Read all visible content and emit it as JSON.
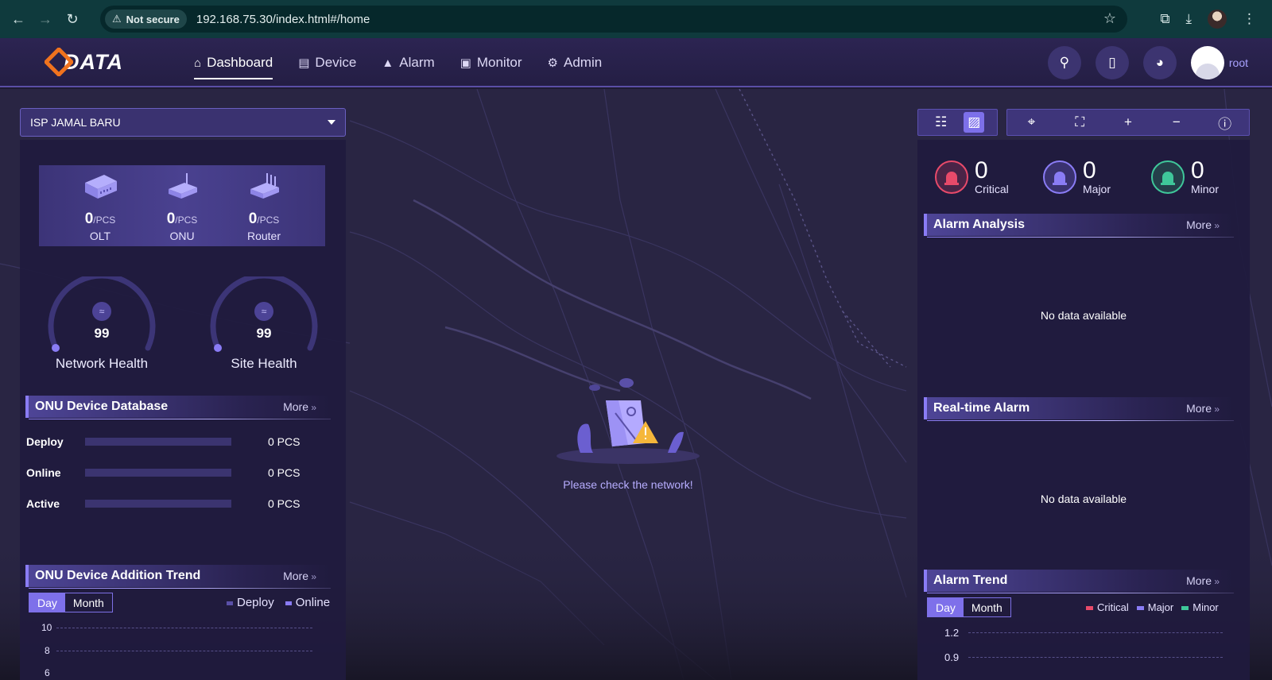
{
  "browser": {
    "security_label": "Not secure",
    "url": "192.168.75.30/index.html#/home"
  },
  "header": {
    "logo_text": "DATA",
    "nav": [
      {
        "label": "Dashboard",
        "icon": "home-icon",
        "active": true
      },
      {
        "label": "Device",
        "icon": "server-icon",
        "active": false
      },
      {
        "label": "Alarm",
        "icon": "siren-icon",
        "active": false
      },
      {
        "label": "Monitor",
        "icon": "monitor-icon",
        "active": false
      },
      {
        "label": "Admin",
        "icon": "gear-icon",
        "active": false
      }
    ],
    "user": "root"
  },
  "left": {
    "org_select": "ISP JAMAL BARU",
    "devices": [
      {
        "count": "0",
        "unit": "/PCS",
        "label": "OLT"
      },
      {
        "count": "0",
        "unit": "/PCS",
        "label": "ONU"
      },
      {
        "count": "0",
        "unit": "/PCS",
        "label": "Router"
      }
    ],
    "gauges": [
      {
        "value": "99",
        "label": "Network Health"
      },
      {
        "value": "99",
        "label": "Site Health"
      }
    ],
    "db": {
      "title": "ONU Device Database",
      "more": "More",
      "rows": [
        {
          "label": "Deploy",
          "value": "0 PCS"
        },
        {
          "label": "Online",
          "value": "0 PCS"
        },
        {
          "label": "Active",
          "value": "0 PCS"
        }
      ]
    },
    "trend": {
      "title": "ONU Device Addition Trend",
      "more": "More",
      "toggle": [
        "Day",
        "Month"
      ],
      "legend": [
        "Deploy",
        "Online"
      ],
      "y_ticks": [
        "10",
        "8",
        "6"
      ]
    }
  },
  "center": {
    "message": "Please check the network!"
  },
  "right": {
    "alarms": [
      {
        "count": "0",
        "label": "Critical",
        "color": "#e84a6a"
      },
      {
        "count": "0",
        "label": "Major",
        "color": "#8a7cf5"
      },
      {
        "count": "0",
        "label": "Minor",
        "color": "#3fc79a"
      }
    ],
    "analysis": {
      "title": "Alarm Analysis",
      "more": "More",
      "empty": "No data available"
    },
    "realtime": {
      "title": "Real-time Alarm",
      "more": "More",
      "empty": "No data available"
    },
    "trend": {
      "title": "Alarm Trend",
      "more": "More",
      "toggle": [
        "Day",
        "Month"
      ],
      "legend": [
        "Critical",
        "Major",
        "Minor"
      ],
      "y_ticks": [
        "1.2",
        "0.9"
      ]
    }
  },
  "colors": {
    "accent": "#7e70ea",
    "critical": "#e84a6a",
    "major": "#8a7cf5",
    "minor": "#3fc79a",
    "deploy": "#5a50a8",
    "online": "#8a7cf5"
  }
}
